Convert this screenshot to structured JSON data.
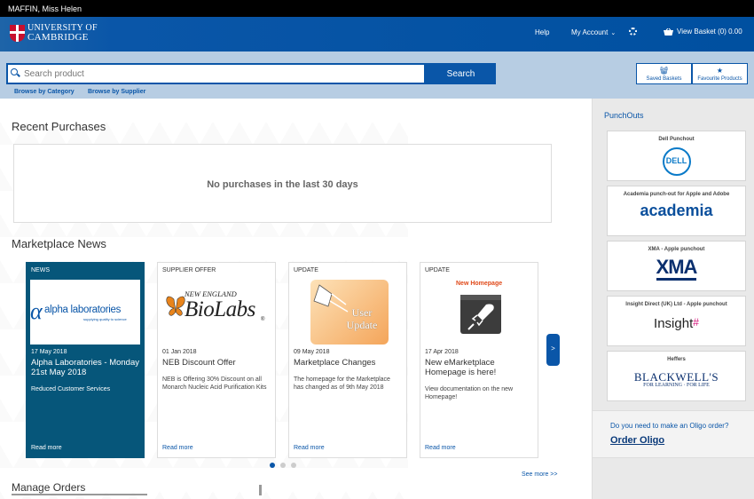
{
  "user": {
    "name": "MAFFIN, Miss Helen"
  },
  "header": {
    "logo_line1": "UNIVERSITY OF",
    "logo_line2": "CAMBRIDGE",
    "help": "Help",
    "my_account": "My Account",
    "basket": "View Basket (0) 0.00"
  },
  "search": {
    "placeholder": "Search product",
    "button": "Search",
    "browse_category": "Browse by Category",
    "browse_supplier": "Browse by Supplier",
    "saved_baskets": "Saved Baskets",
    "favourite_products": "Favourite Products"
  },
  "recent": {
    "title": "Recent Purchases",
    "empty": "No purchases in the last 30 days"
  },
  "news": {
    "title": "Marketplace News",
    "cards": [
      {
        "tag": "NEWS",
        "logo_text": "alpha laboratories",
        "logo_sub": "supplying quality to science",
        "date": "17 May 2018",
        "title": "Alpha Laboratories - Monday 21st May 2018",
        "desc": "Reduced Customer Services",
        "more": "Read more"
      },
      {
        "tag": "SUPPLIER OFFER",
        "logo_text": "BioLabs",
        "logo_top": "NEW ENGLAND",
        "logo_r": "®",
        "date": "01 Jan 2018",
        "title": "NEB Discount Offer",
        "desc": "NEB is Offering 30% Discount on all Monarch Nucleic Acid Purification Kits",
        "more": "Read more"
      },
      {
        "tag": "UPDATE",
        "logo_text": "User Update",
        "date": "09 May 2018",
        "title": "Marketplace Changes",
        "desc": "The homepage for the Marketplace has changed as of 9th May 2018",
        "more": "Read more"
      },
      {
        "tag": "UPDATE",
        "logo_text": "New Homepage",
        "date": "17 Apr 2018",
        "title": "New eMarketplace Homepage is here!",
        "desc": "View documentation on the new Homepage!",
        "more": "Read more"
      }
    ],
    "next": ">",
    "see_more": "See more >>"
  },
  "manage": {
    "title": "Manage Orders"
  },
  "punchouts": {
    "title": "PunchOuts",
    "items": [
      {
        "label": "Dell Punchout",
        "logo": "DELL"
      },
      {
        "label": "Academia punch-out for Apple and Adobe",
        "logo": "academia"
      },
      {
        "label": "XMA - Apple punchout",
        "logo": "XMA"
      },
      {
        "label": "Insight Direct (UK) Ltd - Apple punchout",
        "logo": "Insight"
      },
      {
        "label": "Heffers",
        "logo": "BLACKWELL'S",
        "logo_sub": "FOR LEARNING · FOR LIFE"
      }
    ]
  },
  "oligo": {
    "question": "Do you need to make an Oligo order?",
    "link": "Order Oligo"
  },
  "colors": {
    "primary": "#0a56a8",
    "news_dark": "#06567a",
    "search_band": "#b7cde3"
  }
}
